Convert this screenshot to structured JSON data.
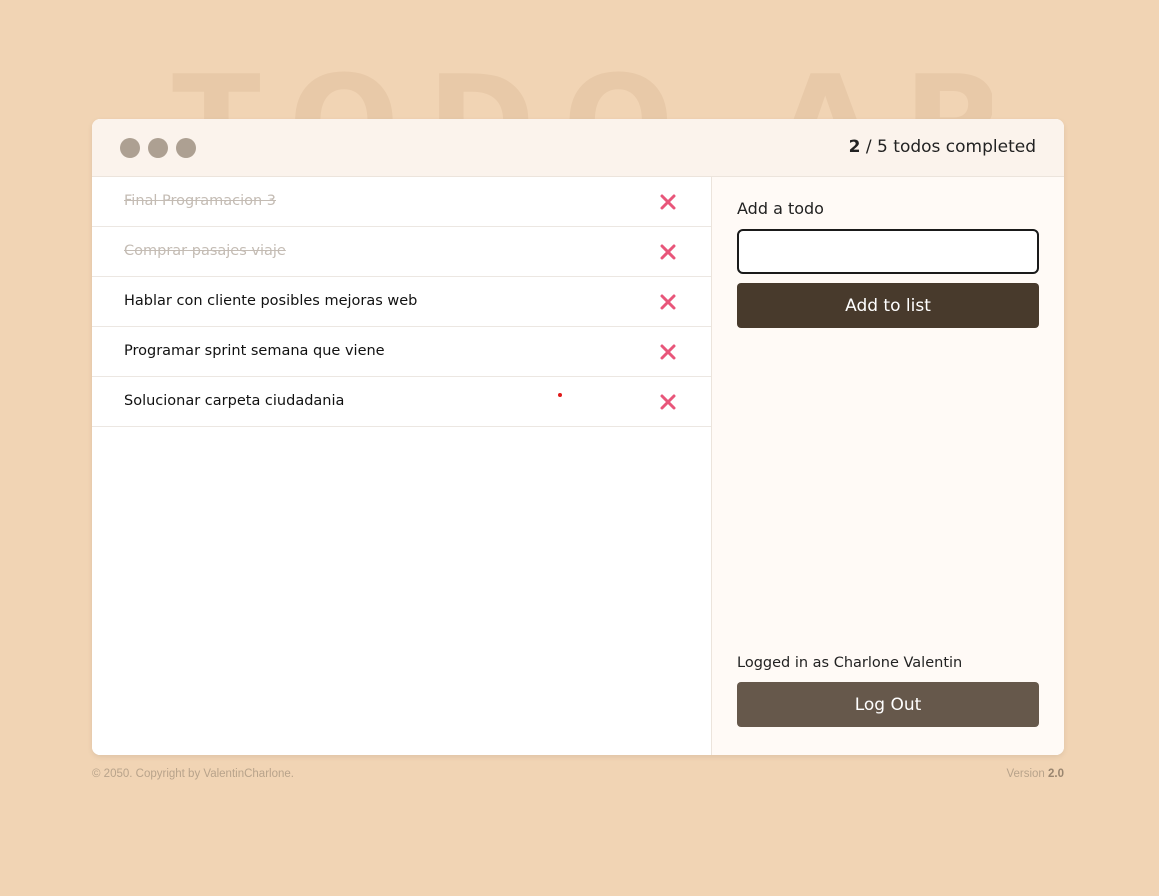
{
  "background_title": "TODO APP",
  "header": {
    "completed_count": "2",
    "total_text": "/ 5 todos completed"
  },
  "todos": [
    {
      "text": "Final Programacion 3",
      "completed": true
    },
    {
      "text": "Comprar pasajes viaje",
      "completed": true
    },
    {
      "text": "Hablar con cliente posibles mejoras web",
      "completed": false
    },
    {
      "text": "Programar sprint semana que viene",
      "completed": false
    },
    {
      "text": "Solucionar carpeta ciudadania",
      "completed": false
    }
  ],
  "form": {
    "label": "Add a todo",
    "input_value": "",
    "add_button": "Add to list"
  },
  "session": {
    "logged_in_text": "Logged in as Charlone Valentin",
    "logout_button": "Log Out"
  },
  "footer": {
    "copyright": "© 2050. Copyright by ValentinCharlone.",
    "version_label": "Version",
    "version_number": "2.0"
  },
  "icons": {
    "window_dots": "window-dot-icon",
    "delete": "close-icon"
  },
  "colors": {
    "page_background": "#f1d4b4",
    "delete_icon": "#e8567a",
    "add_button": "#483a2c",
    "logout_button": "#66584b",
    "window_dots": "#ada092"
  }
}
